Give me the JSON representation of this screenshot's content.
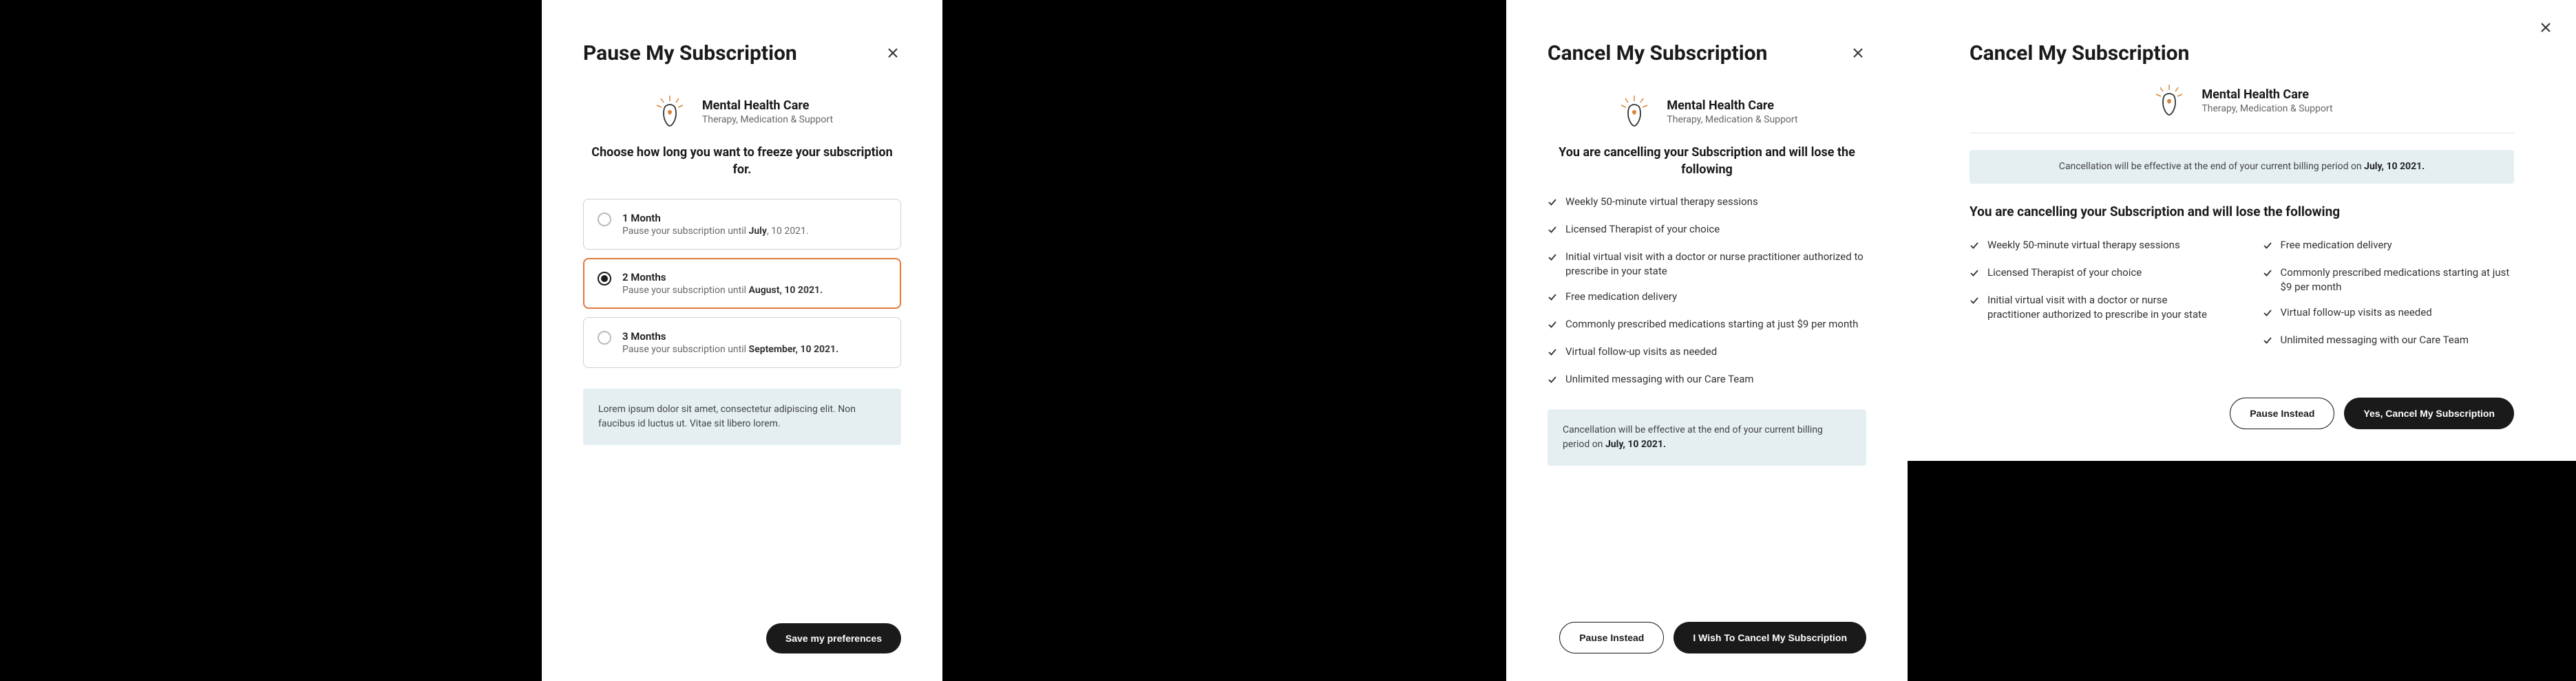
{
  "panel1": {
    "title": "Pause My Subscription",
    "service_title": "Mental Health Care",
    "service_subtitle": "Therapy, Medication & Support",
    "subtitle": "Choose how long you want to freeze your subscription for.",
    "options": [
      {
        "label": "1 Month",
        "desc_prefix": "Pause your subscription until ",
        "desc_bold": "July",
        "desc_suffix": ", 10 2021."
      },
      {
        "label": "2 Months",
        "desc_prefix": "Pause your subscription until ",
        "desc_bold": "August, 10 2021.",
        "desc_suffix": ""
      },
      {
        "label": "3 Months",
        "desc_prefix": "Pause your subscription until ",
        "desc_bold": "September, 10 2021.",
        "desc_suffix": ""
      }
    ],
    "selected_index": 1,
    "info_text": "Lorem ipsum dolor sit amet, consectetur adipiscing elit. Non faucibus id luctus ut. Vitae sit libero lorem.",
    "save_label": "Save my preferences"
  },
  "panel2": {
    "title": "Cancel My Subscription",
    "service_title": "Mental Health Care",
    "service_subtitle": "Therapy, Medication & Support",
    "heading": "You are cancelling your Subscription and will lose the following",
    "features": [
      "Weekly 50-minute virtual therapy sessions",
      "Licensed Therapist of your choice",
      "Initial virtual visit with a doctor or nurse practitioner authorized to prescribe in your state",
      "Free medication delivery",
      "Commonly prescribed medications starting at just $9 per month",
      "Virtual follow-up visits as needed",
      "Unlimited messaging with our Care Team"
    ],
    "info_prefix": "Cancellation will be effective at the end of your current billing period on ",
    "info_bold": "July, 10 2021.",
    "pause_label": "Pause Instead",
    "cancel_label": "I Wish To Cancel My Subscription"
  },
  "panel3": {
    "title": "Cancel My Subscription",
    "service_title": "Mental Health Care",
    "service_subtitle": "Therapy, Medication & Support",
    "info_prefix": "Cancellation will be effective at the end of your current billing period on ",
    "info_bold": "July, 10 2021.",
    "heading": "You are cancelling your Subscription and will lose the following",
    "features_left": [
      "Weekly 50-minute virtual therapy sessions",
      "Licensed Therapist of your choice",
      "Initial virtual visit with a doctor or nurse practitioner authorized to prescribe in your state"
    ],
    "features_right": [
      "Free medication delivery",
      "Commonly prescribed medications starting at just $9 per month",
      "Virtual follow-up visits as needed",
      "Unlimited messaging with our Care Team"
    ],
    "pause_label": "Pause Instead",
    "cancel_label": "Yes, Cancel My Subscription"
  }
}
